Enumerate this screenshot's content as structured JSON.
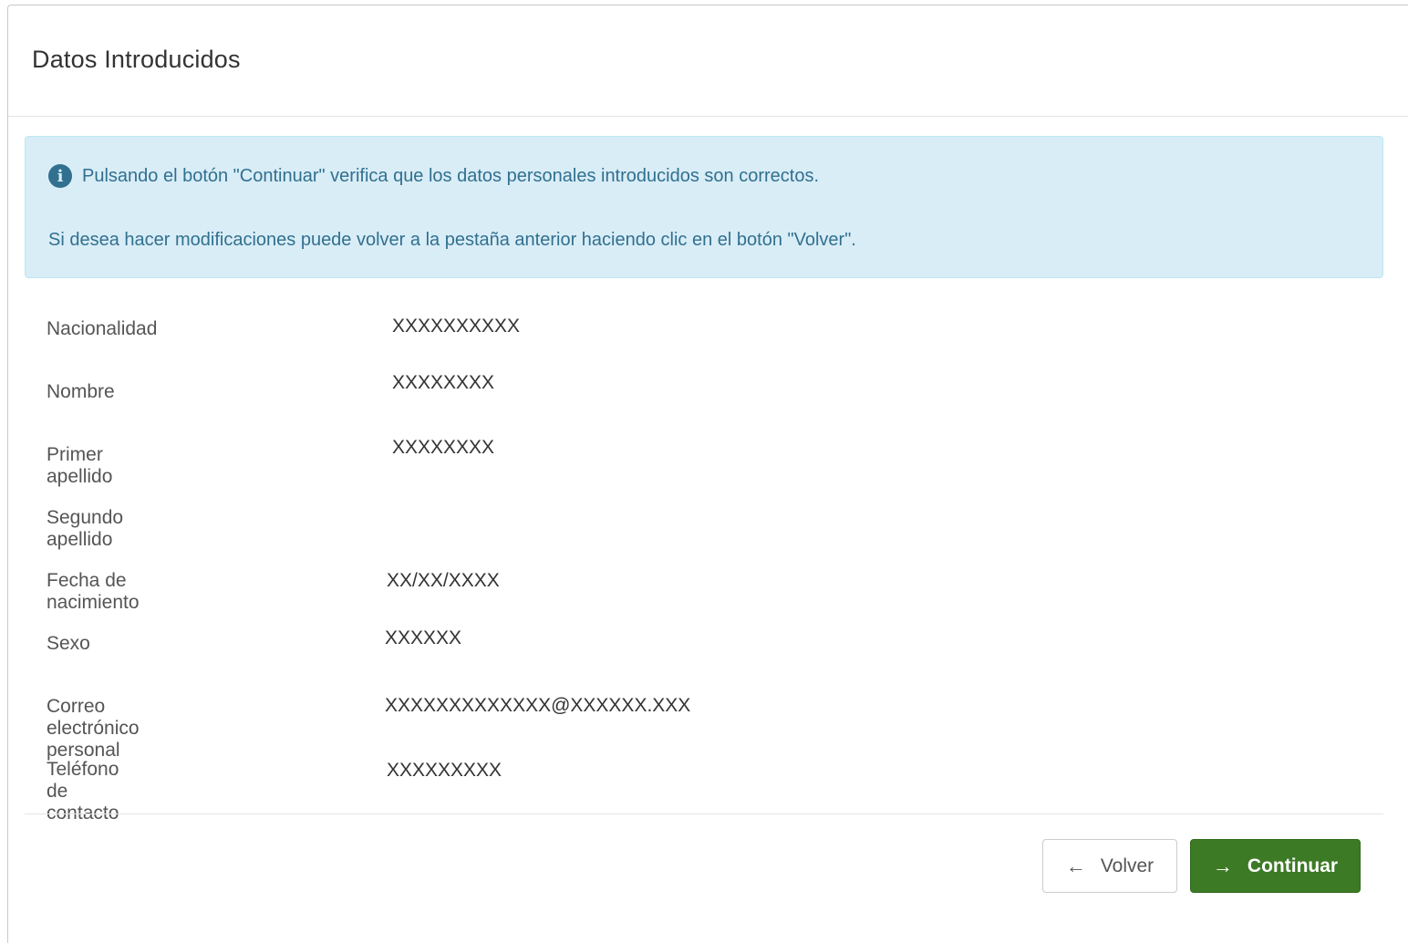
{
  "modal": {
    "title": "Datos Introducidos"
  },
  "alert": {
    "icon": "info-circle-icon",
    "line1": "Pulsando el botón \"Continuar\" verifica que los datos personales introducidos son correctos.",
    "line2": "Si desea hacer modificaciones puede volver a la pestaña anterior haciendo clic en el botón \"Volver\"."
  },
  "fields": [
    {
      "label": "Nacionalidad",
      "value": "XXXXXXXXXX"
    },
    {
      "label": "Nombre",
      "value": "XXXXXXXX"
    },
    {
      "label": "Primer apellido",
      "value": "XXXXXXXX"
    },
    {
      "label": "Segundo apellido",
      "value": ""
    },
    {
      "label": "Fecha de nacimiento",
      "value": "XX/XX/XXXX"
    },
    {
      "label": "Sexo",
      "value": "XXXXXX"
    },
    {
      "label": "Correo electrónico personal",
      "value": "XXXXXXXXXXXXX@XXXXXX.XXX"
    },
    {
      "label": "Teléfono de contacto",
      "value": "XXXXXXXXX"
    }
  ],
  "footer": {
    "back_label": "Volver",
    "back_icon": "arrow-left-icon",
    "continue_label": "Continuar",
    "continue_icon": "arrow-right-icon"
  },
  "colors": {
    "alert_bg": "#d9edf7",
    "alert_text": "#31708f",
    "primary_button": "#3d7a25"
  }
}
